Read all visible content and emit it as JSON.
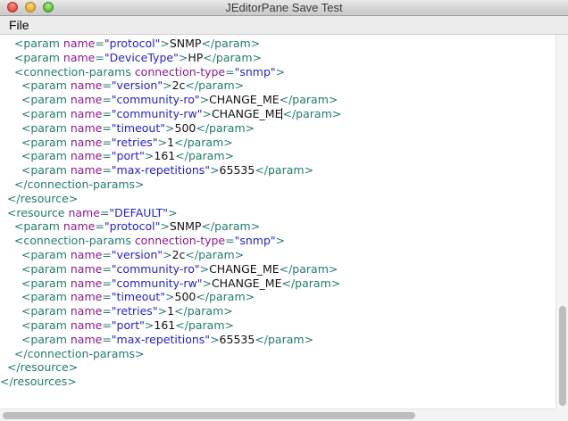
{
  "window": {
    "title": "JEditorPane Save Test"
  },
  "menu": {
    "file_label": "File"
  },
  "scroll": {
    "vertical_top_fraction": 0.73,
    "vertical_size_fraction": 0.27,
    "horizontal_size_fraction": 0.75
  },
  "editor": {
    "lines": [
      [
        {
          "k": "t",
          "s": "    <param "
        },
        {
          "k": "a",
          "s": "name"
        },
        {
          "k": "t",
          "s": "="
        },
        {
          "k": "v",
          "s": "\"protocol\""
        },
        {
          "k": "t",
          "s": ">"
        },
        {
          "k": "x",
          "s": "SNMP"
        },
        {
          "k": "t",
          "s": "</param>"
        }
      ],
      [
        {
          "k": "t",
          "s": "    <param "
        },
        {
          "k": "a",
          "s": "name"
        },
        {
          "k": "t",
          "s": "="
        },
        {
          "k": "v",
          "s": "\"DeviceType\""
        },
        {
          "k": "t",
          "s": ">"
        },
        {
          "k": "x",
          "s": "HP"
        },
        {
          "k": "t",
          "s": "</param>"
        }
      ],
      [
        {
          "k": "t",
          "s": "    <connection-params "
        },
        {
          "k": "a",
          "s": "connection-type"
        },
        {
          "k": "t",
          "s": "="
        },
        {
          "k": "v",
          "s": "\"snmp\""
        },
        {
          "k": "t",
          "s": ">"
        }
      ],
      [
        {
          "k": "t",
          "s": "      <param "
        },
        {
          "k": "a",
          "s": "name"
        },
        {
          "k": "t",
          "s": "="
        },
        {
          "k": "v",
          "s": "\"version\""
        },
        {
          "k": "t",
          "s": ">"
        },
        {
          "k": "x",
          "s": "2c"
        },
        {
          "k": "t",
          "s": "</param>"
        }
      ],
      [
        {
          "k": "t",
          "s": "      <param "
        },
        {
          "k": "a",
          "s": "name"
        },
        {
          "k": "t",
          "s": "="
        },
        {
          "k": "v",
          "s": "\"community-ro\""
        },
        {
          "k": "t",
          "s": ">"
        },
        {
          "k": "x",
          "s": "CHANGE_ME"
        },
        {
          "k": "t",
          "s": "</param>"
        }
      ],
      [
        {
          "k": "t",
          "s": "      <param "
        },
        {
          "k": "a",
          "s": "name"
        },
        {
          "k": "t",
          "s": "="
        },
        {
          "k": "v",
          "s": "\"community-rw\""
        },
        {
          "k": "t",
          "s": ">"
        },
        {
          "k": "x",
          "s": "CHANGE_ME"
        },
        {
          "k": "c",
          "s": ""
        },
        {
          "k": "t",
          "s": "</param>"
        }
      ],
      [
        {
          "k": "t",
          "s": "      <param "
        },
        {
          "k": "a",
          "s": "name"
        },
        {
          "k": "t",
          "s": "="
        },
        {
          "k": "v",
          "s": "\"timeout\""
        },
        {
          "k": "t",
          "s": ">"
        },
        {
          "k": "x",
          "s": "500"
        },
        {
          "k": "t",
          "s": "</param>"
        }
      ],
      [
        {
          "k": "t",
          "s": "      <param "
        },
        {
          "k": "a",
          "s": "name"
        },
        {
          "k": "t",
          "s": "="
        },
        {
          "k": "v",
          "s": "\"retries\""
        },
        {
          "k": "t",
          "s": ">"
        },
        {
          "k": "x",
          "s": "1"
        },
        {
          "k": "t",
          "s": "</param>"
        }
      ],
      [
        {
          "k": "t",
          "s": "      <param "
        },
        {
          "k": "a",
          "s": "name"
        },
        {
          "k": "t",
          "s": "="
        },
        {
          "k": "v",
          "s": "\"port\""
        },
        {
          "k": "t",
          "s": ">"
        },
        {
          "k": "x",
          "s": "161"
        },
        {
          "k": "t",
          "s": "</param>"
        }
      ],
      [
        {
          "k": "t",
          "s": "      <param "
        },
        {
          "k": "a",
          "s": "name"
        },
        {
          "k": "t",
          "s": "="
        },
        {
          "k": "v",
          "s": "\"max-repetitions\""
        },
        {
          "k": "t",
          "s": ">"
        },
        {
          "k": "x",
          "s": "65535"
        },
        {
          "k": "t",
          "s": "</param>"
        }
      ],
      [
        {
          "k": "t",
          "s": "    </connection-params>"
        }
      ],
      [
        {
          "k": "t",
          "s": "  </resource>"
        }
      ],
      [
        {
          "k": "t",
          "s": "  <resource "
        },
        {
          "k": "a",
          "s": "name"
        },
        {
          "k": "t",
          "s": "="
        },
        {
          "k": "v",
          "s": "\"DEFAULT\""
        },
        {
          "k": "t",
          "s": ">"
        }
      ],
      [
        {
          "k": "t",
          "s": "    <param "
        },
        {
          "k": "a",
          "s": "name"
        },
        {
          "k": "t",
          "s": "="
        },
        {
          "k": "v",
          "s": "\"protocol\""
        },
        {
          "k": "t",
          "s": ">"
        },
        {
          "k": "x",
          "s": "SNMP"
        },
        {
          "k": "t",
          "s": "</param>"
        }
      ],
      [
        {
          "k": "t",
          "s": "    <connection-params "
        },
        {
          "k": "a",
          "s": "connection-type"
        },
        {
          "k": "t",
          "s": "="
        },
        {
          "k": "v",
          "s": "\"snmp\""
        },
        {
          "k": "t",
          "s": ">"
        }
      ],
      [
        {
          "k": "t",
          "s": "      <param "
        },
        {
          "k": "a",
          "s": "name"
        },
        {
          "k": "t",
          "s": "="
        },
        {
          "k": "v",
          "s": "\"version\""
        },
        {
          "k": "t",
          "s": ">"
        },
        {
          "k": "x",
          "s": "2c"
        },
        {
          "k": "t",
          "s": "</param>"
        }
      ],
      [
        {
          "k": "t",
          "s": "      <param "
        },
        {
          "k": "a",
          "s": "name"
        },
        {
          "k": "t",
          "s": "="
        },
        {
          "k": "v",
          "s": "\"community-ro\""
        },
        {
          "k": "t",
          "s": ">"
        },
        {
          "k": "x",
          "s": "CHANGE_ME"
        },
        {
          "k": "t",
          "s": "</param>"
        }
      ],
      [
        {
          "k": "t",
          "s": "      <param "
        },
        {
          "k": "a",
          "s": "name"
        },
        {
          "k": "t",
          "s": "="
        },
        {
          "k": "v",
          "s": "\"community-rw\""
        },
        {
          "k": "t",
          "s": ">"
        },
        {
          "k": "x",
          "s": "CHANGE_ME"
        },
        {
          "k": "t",
          "s": "</param>"
        }
      ],
      [
        {
          "k": "t",
          "s": "      <param "
        },
        {
          "k": "a",
          "s": "name"
        },
        {
          "k": "t",
          "s": "="
        },
        {
          "k": "v",
          "s": "\"timeout\""
        },
        {
          "k": "t",
          "s": ">"
        },
        {
          "k": "x",
          "s": "500"
        },
        {
          "k": "t",
          "s": "</param>"
        }
      ],
      [
        {
          "k": "t",
          "s": "      <param "
        },
        {
          "k": "a",
          "s": "name"
        },
        {
          "k": "t",
          "s": "="
        },
        {
          "k": "v",
          "s": "\"retries\""
        },
        {
          "k": "t",
          "s": ">"
        },
        {
          "k": "x",
          "s": "1"
        },
        {
          "k": "t",
          "s": "</param>"
        }
      ],
      [
        {
          "k": "t",
          "s": "      <param "
        },
        {
          "k": "a",
          "s": "name"
        },
        {
          "k": "t",
          "s": "="
        },
        {
          "k": "v",
          "s": "\"port\""
        },
        {
          "k": "t",
          "s": ">"
        },
        {
          "k": "x",
          "s": "161"
        },
        {
          "k": "t",
          "s": "</param>"
        }
      ],
      [
        {
          "k": "t",
          "s": "      <param "
        },
        {
          "k": "a",
          "s": "name"
        },
        {
          "k": "t",
          "s": "="
        },
        {
          "k": "v",
          "s": "\"max-repetitions\""
        },
        {
          "k": "t",
          "s": ">"
        },
        {
          "k": "x",
          "s": "65535"
        },
        {
          "k": "t",
          "s": "</param>"
        }
      ],
      [
        {
          "k": "t",
          "s": "    </connection-params>"
        }
      ],
      [
        {
          "k": "t",
          "s": "  </resource>"
        }
      ],
      [
        {
          "k": "t",
          "s": "</resources>"
        }
      ]
    ]
  }
}
